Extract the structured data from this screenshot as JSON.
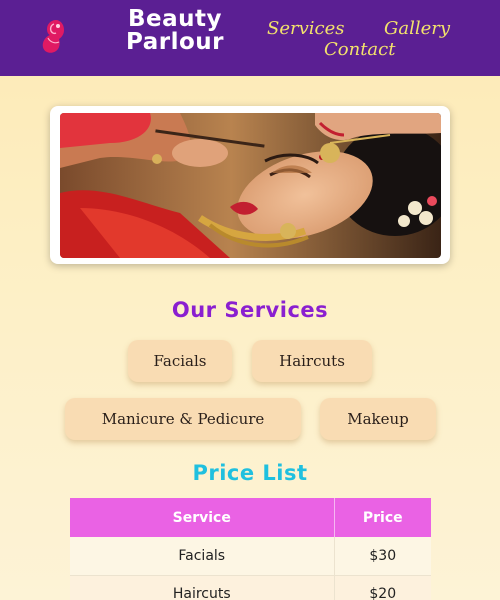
{
  "header": {
    "brand_line1": "Beauty",
    "brand_line2": "Parlour",
    "logo_icon": "lady-silhouette-icon",
    "nav": [
      "Services",
      "Gallery",
      "Contact"
    ]
  },
  "hero": {
    "image": "bridal-makeup-photo"
  },
  "services": {
    "title": "Our Services",
    "items": [
      "Facials",
      "Haircuts",
      "Manicure & Pedicure",
      "Makeup"
    ]
  },
  "price_list": {
    "title": "Price List",
    "columns": [
      "Service",
      "Price"
    ],
    "rows": [
      {
        "service": "Facials",
        "price": "$30"
      },
      {
        "service": "Haircuts",
        "price": "$20"
      }
    ]
  },
  "colors": {
    "header_bg": "#5b1f93",
    "nav_text": "#f3e26c",
    "services_title": "#8a1fd0",
    "price_title": "#1fc0df",
    "table_header_bg": "#ea62e4",
    "pill_bg": "#f9dcb3"
  }
}
